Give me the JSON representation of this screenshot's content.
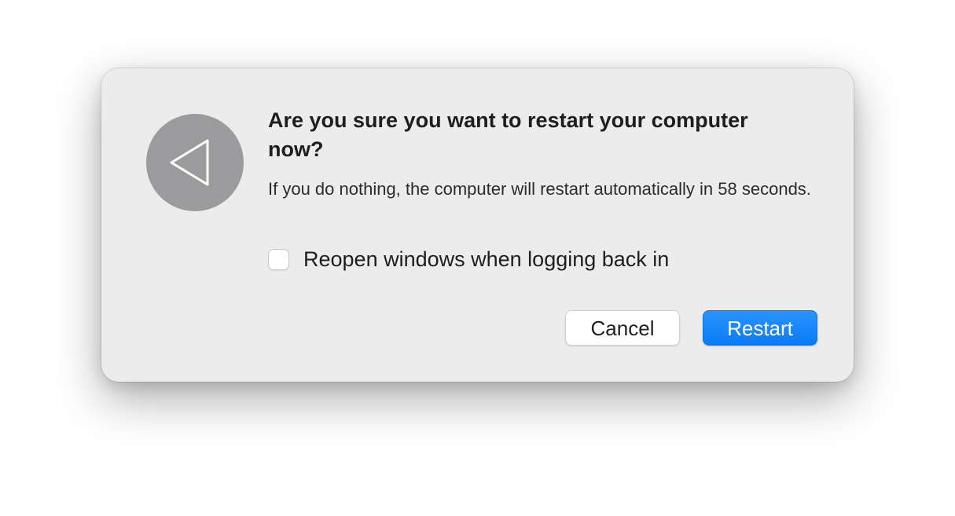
{
  "dialog": {
    "icon": "back-triangle-icon",
    "title": "Are you sure you want to restart your computer now?",
    "message": "If you do nothing, the computer will restart automatically in 58 seconds.",
    "checkbox": {
      "label": "Reopen windows when logging back in",
      "checked": false
    },
    "buttons": {
      "cancel_label": "Cancel",
      "restart_label": "Restart"
    }
  },
  "colors": {
    "accent": "#0a7bf5",
    "dialog_background": "#ececec",
    "icon_circle": "#9b9b9e"
  }
}
